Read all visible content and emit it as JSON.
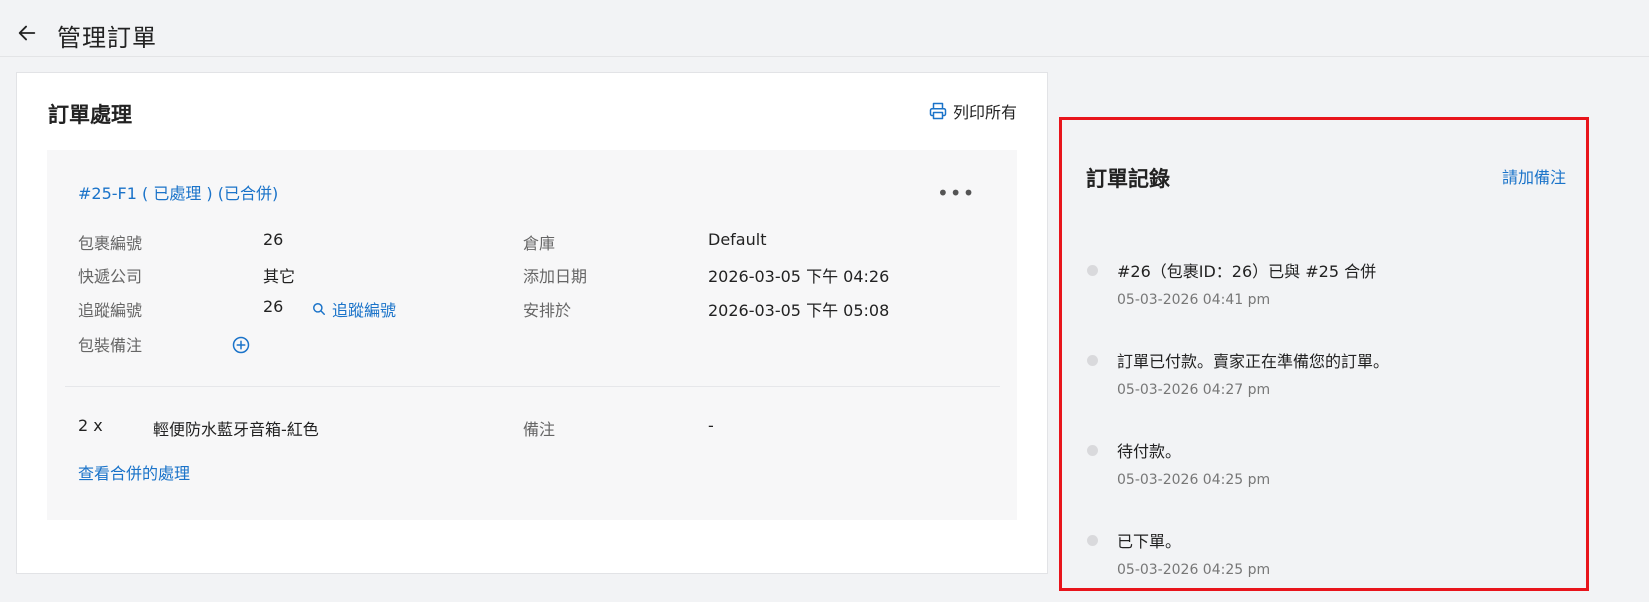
{
  "header": {
    "title": "管理訂單"
  },
  "fulfillment": {
    "title": "訂單處理",
    "print_all": "列印所有",
    "package": {
      "id_label": "#25-F1 ( 已處理 ) (已合併)",
      "more": "•••",
      "fields": {
        "package_no_label": "包裹編號",
        "package_no": "26",
        "courier_label": "快遞公司",
        "courier": "其它",
        "tracking_label": "追蹤編號",
        "tracking_no": "26",
        "tracking_link": "追蹤編號",
        "packing_note_label": "包裝備注",
        "warehouse_label": "倉庫",
        "warehouse": "Default",
        "added_date_label": "添加日期",
        "added_date": "2026-03-05 下午 04:26",
        "scheduled_label": "安排於",
        "scheduled": "2026-03-05 下午 05:08"
      },
      "items": [
        {
          "qty": "2 x",
          "name": "輕便防水藍牙音箱-紅色",
          "note_label": "備注",
          "note": "-"
        }
      ],
      "view_merged": "查看合併的處理"
    }
  },
  "history": {
    "title": "訂單記錄",
    "add_note": "請加備注",
    "entries": [
      {
        "text": "#26（包裹ID：26）已與 #25 合併",
        "time": "05-03-2026 04:41 pm"
      },
      {
        "text": "訂單已付款。賣家正在準備您的訂單。",
        "time": "05-03-2026 04:27 pm"
      },
      {
        "text": "待付款。",
        "time": "05-03-2026 04:25 pm"
      },
      {
        "text": "已下單。",
        "time": "05-03-2026 04:25 pm"
      }
    ]
  },
  "colors": {
    "link": "#1a73c9",
    "highlight_border": "#e8141b"
  },
  "icons": {
    "back": "arrow-left-icon",
    "print": "printer-icon",
    "search": "search-icon",
    "add": "plus-circle-icon"
  }
}
